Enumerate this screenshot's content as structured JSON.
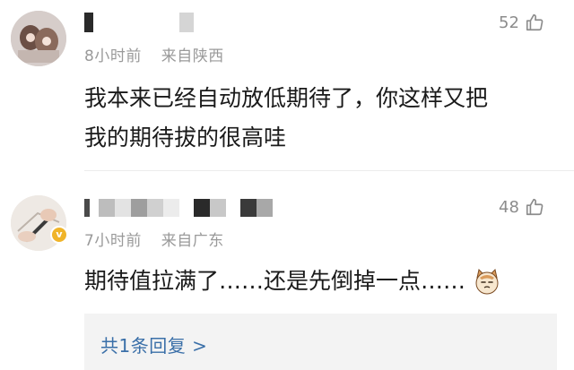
{
  "comments": [
    {
      "time": "8小时前",
      "location": "来自陕西",
      "likes": "52",
      "text_lines": [
        "我本来已经自动放低期待了，你这样又把",
        "我的期待拔的很高哇"
      ]
    },
    {
      "time": "7小时前",
      "location": "来自广东",
      "likes": "48",
      "verified_badge": "v",
      "text": "期待值拉满了……还是先倒掉一点……"
    }
  ],
  "replies_link": "共1条回复 >",
  "colors": {
    "meta": "#9a9a9a",
    "link": "#3a6fa8",
    "badge": "#f0b429",
    "reply_bg": "#f3f3f3"
  },
  "icons": [
    "thumbs-up-icon",
    "cat-emoji-icon",
    "verified-badge-icon"
  ]
}
